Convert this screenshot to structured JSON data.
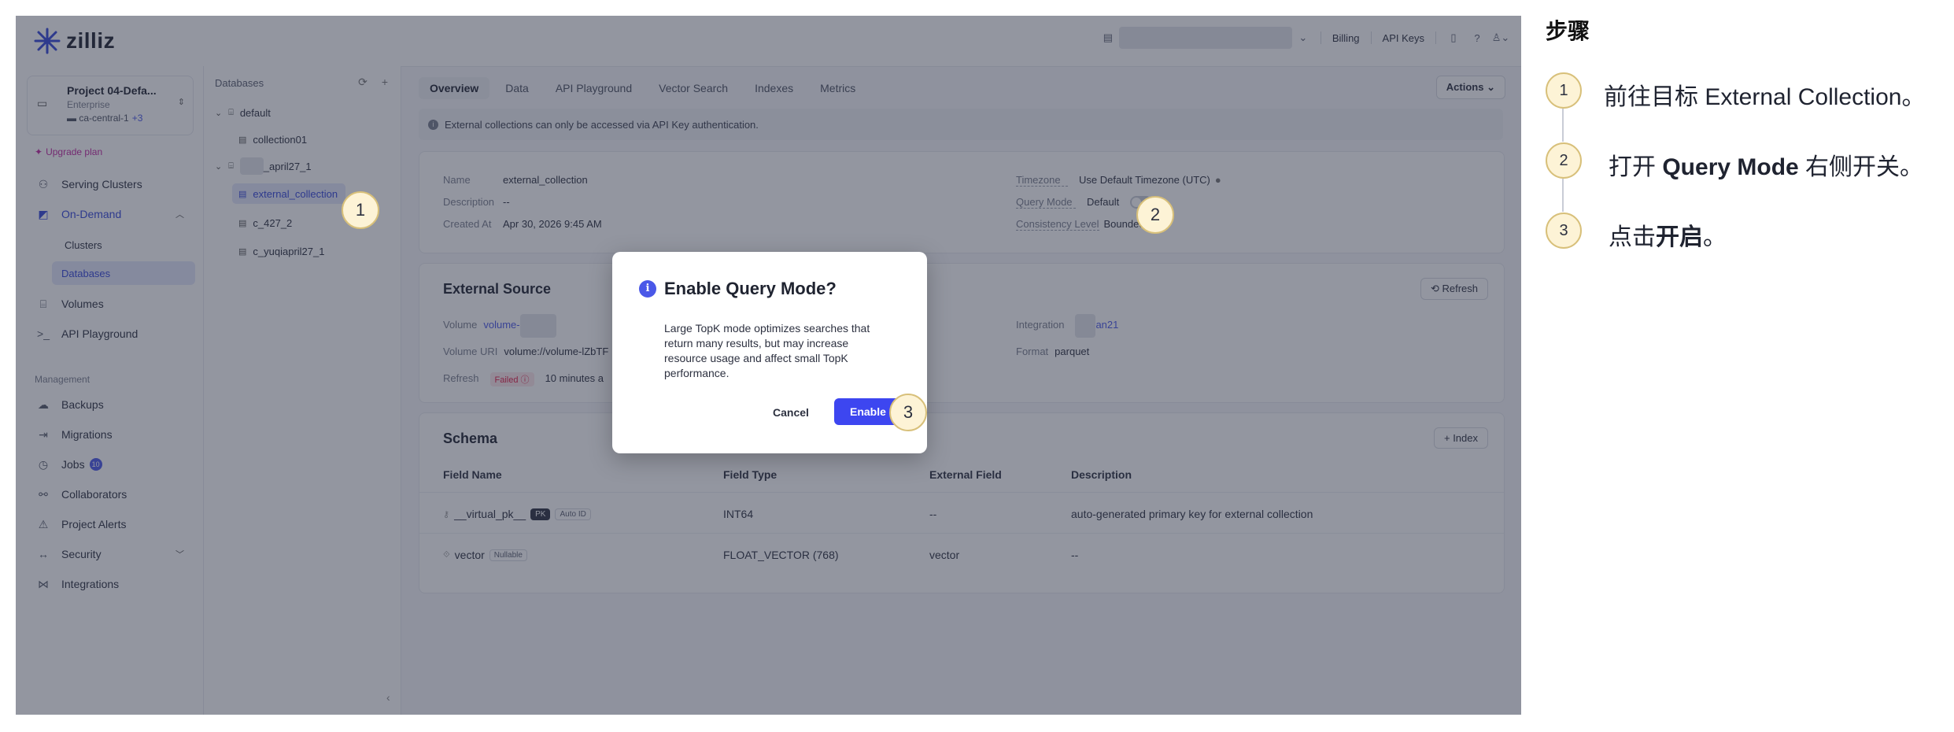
{
  "app": {
    "brand": "zilliz",
    "top_nav": [
      "Billing",
      "API Keys"
    ]
  },
  "sidebar": {
    "project_name": "Project 04-Defa...",
    "project_tier": "Enterprise",
    "project_region": "ca-central-1",
    "project_region_extra": "+3",
    "upgrade_label": "Upgrade plan",
    "items": [
      {
        "label": "Serving Clusters",
        "icon": "clusters-icon"
      },
      {
        "label": "On-Demand",
        "icon": "on-demand-icon"
      },
      {
        "label": "Clusters"
      },
      {
        "label": "Databases"
      },
      {
        "label": "Volumes",
        "icon": "volume-icon"
      },
      {
        "label": "API Playground",
        "icon": "terminal-icon"
      }
    ],
    "management_label": "Management",
    "management_items": [
      {
        "label": "Backups",
        "icon": "backup-icon"
      },
      {
        "label": "Migrations",
        "icon": "migration-icon"
      },
      {
        "label": "Jobs",
        "icon": "jobs-icon",
        "badge": "10"
      },
      {
        "label": "Collaborators",
        "icon": "collaborators-icon"
      },
      {
        "label": "Project Alerts",
        "icon": "alert-icon"
      },
      {
        "label": "Security",
        "icon": "security-icon"
      },
      {
        "label": "Integrations",
        "icon": "integrations-icon"
      }
    ]
  },
  "db_tree": {
    "header": "Databases",
    "db1": "default",
    "db1_coll": "collection01",
    "db2_suffix": "_april27_1",
    "db2_colls": [
      "external_collection",
      "c_427_2",
      "c_yuqiapril27_1"
    ]
  },
  "main": {
    "tabs": [
      "Overview",
      "Data",
      "API Playground",
      "Vector Search",
      "Indexes",
      "Metrics"
    ],
    "actions_label": "Actions",
    "info_text": "External collections can only be accessed via API Key authentication.",
    "overview": {
      "name_label": "Name",
      "name_value": "external_collection",
      "desc_label": "Description",
      "desc_value": "--",
      "created_label": "Created At",
      "created_value": "Apr 30, 2026 9:45 AM",
      "tz_label": "Timezone",
      "tz_value": "Use Default Timezone (UTC)",
      "qm_label": "Query Mode",
      "qm_value": "Default",
      "cl_label": "Consistency Level",
      "cl_value": "Bounded"
    },
    "external_source": {
      "title": "External Source",
      "refresh_btn": "Refresh",
      "volume_label": "Volume",
      "volume_value": "volume-",
      "uri_label": "Volume URI",
      "uri_value": "volume://volume-lZbTF",
      "refresh_label": "Refresh",
      "refresh_status": "Failed",
      "refresh_time": "10 minutes a",
      "integration_label": "Integration",
      "integration_value": "an21",
      "format_label": "Format",
      "format_value": "parquet"
    },
    "schema": {
      "title": "Schema",
      "index_btn": "Index",
      "headers": [
        "Field Name",
        "Field Type",
        "External Field",
        "Description"
      ],
      "rows": [
        {
          "name": "__virtual_pk__",
          "chips": [
            "PK",
            "Auto ID"
          ],
          "type": "INT64",
          "ext": "--",
          "desc": "auto-generated primary key for external collection"
        },
        {
          "name": "vector",
          "chips": [
            "Nullable"
          ],
          "type": "FLOAT_VECTOR (768)",
          "ext": "vector",
          "desc": "--"
        }
      ]
    }
  },
  "modal": {
    "title": "Enable Query Mode?",
    "body": "Large TopK mode optimizes searches that return many results, but may increase resource usage and affect small TopK performance.",
    "cancel": "Cancel",
    "enable": "Enable"
  },
  "callouts": [
    "1",
    "2",
    "3"
  ],
  "steps": {
    "title": "步骤",
    "items": [
      {
        "num": "1",
        "pre": "前往目标 External Collection。",
        "bold": "",
        "post": ""
      },
      {
        "num": "2",
        "pre": "打开 ",
        "bold": "Query Mode",
        "post": " 右侧开关。"
      },
      {
        "num": "3",
        "pre": "点击",
        "bold": "开启",
        "post": "。"
      }
    ]
  }
}
